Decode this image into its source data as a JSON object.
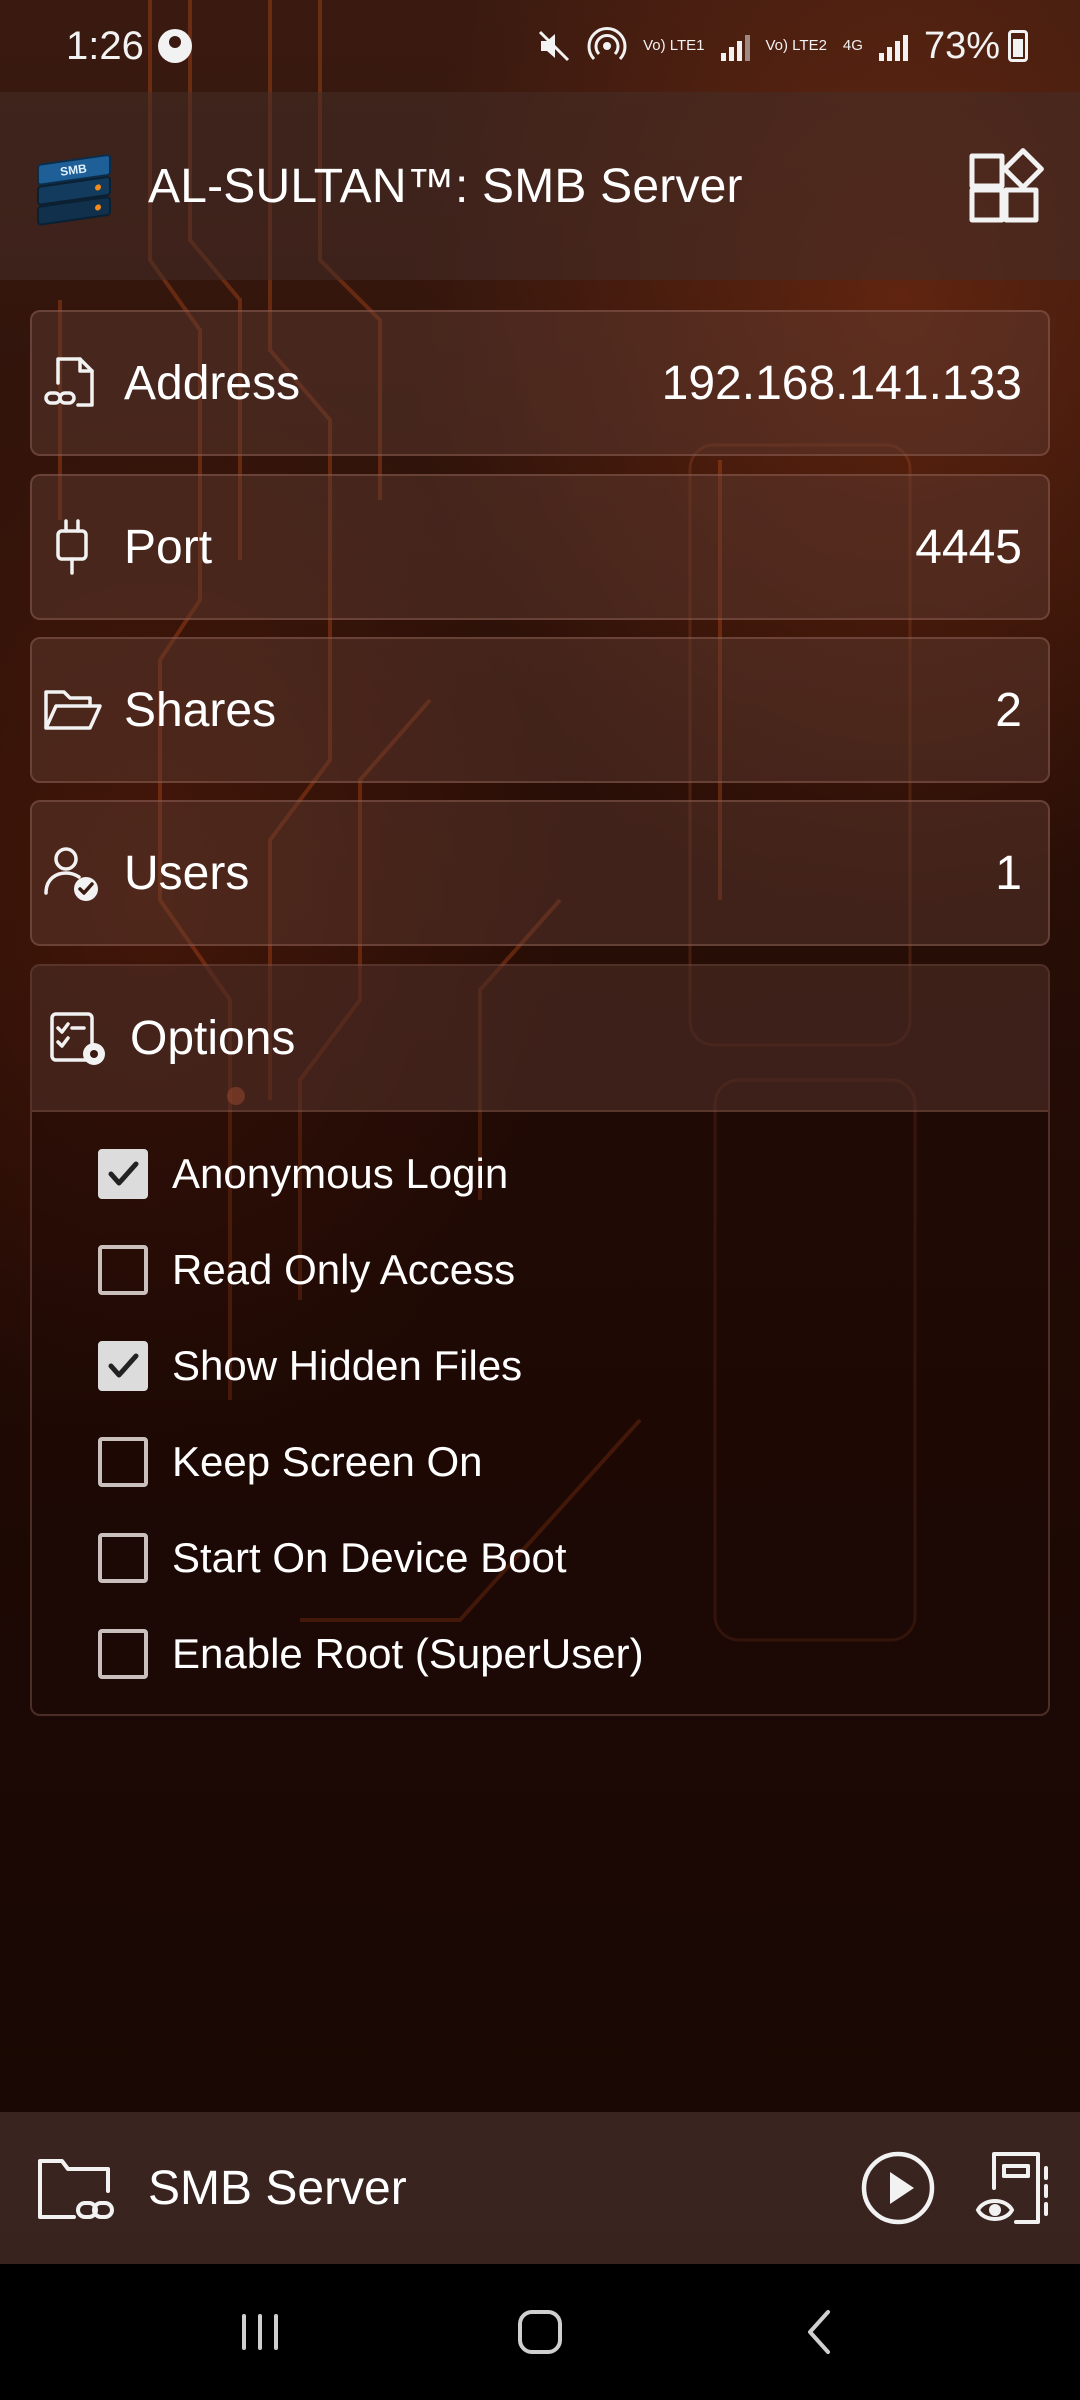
{
  "status_bar": {
    "time": "1:26",
    "network1": "Vo) LTE1",
    "network2": "Vo) LTE2",
    "network_type": "4G",
    "battery": "73%"
  },
  "app": {
    "title": "AL-SULTAN™: SMB Server",
    "logo_text": "SMB"
  },
  "info": {
    "address_label": "Address",
    "address_value": "192.168.141.133",
    "port_label": "Port",
    "port_value": "4445",
    "shares_label": "Shares",
    "shares_value": "2",
    "users_label": "Users",
    "users_value": "1"
  },
  "options": {
    "title": "Options",
    "items": [
      {
        "label": "Anonymous Login",
        "checked": true
      },
      {
        "label": "Read Only Access",
        "checked": false
      },
      {
        "label": "Show Hidden Files",
        "checked": true
      },
      {
        "label": "Keep Screen On",
        "checked": false
      },
      {
        "label": "Start On Device Boot",
        "checked": false
      },
      {
        "label": "Enable Root (SuperUser)",
        "checked": false
      }
    ]
  },
  "bottom_bar": {
    "title": "SMB Server"
  },
  "icons": {
    "address": "file-link-icon",
    "port": "plug-icon",
    "shares": "folder-open-icon",
    "users": "user-check-icon",
    "options": "settings-checklist-icon",
    "header_action": "widgets-icon",
    "start": "play-icon",
    "logs": "log-view-icon"
  },
  "colors": {
    "background": "#1c0a05",
    "card": "#5f3c32",
    "text": "#ffffff",
    "checkbox_checked": "#dcdcdc"
  }
}
